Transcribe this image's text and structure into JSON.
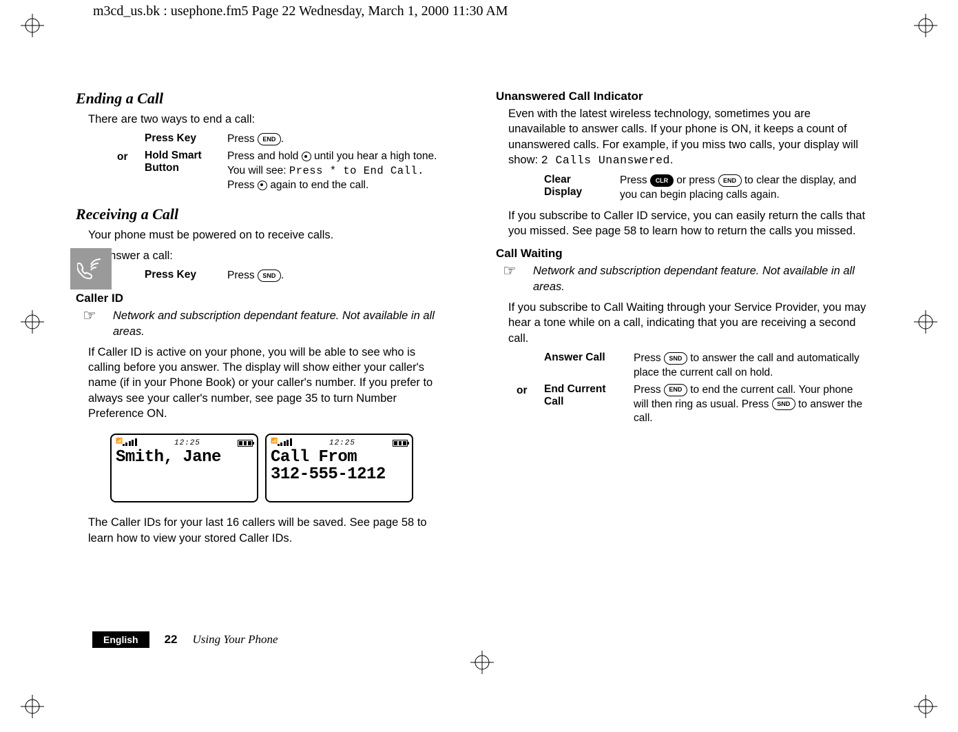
{
  "running_header": "m3cd_us.bk : usephone.fm5  Page 22  Wednesday, March 1, 2000  11:30 AM",
  "left": {
    "ending": {
      "title": "Ending a Call",
      "intro": "There are two ways to end a call:",
      "press_key_label": "Press Key",
      "press_key_desc_prefix": "Press ",
      "press_key_desc_suffix": ".",
      "or": "or",
      "hold_label_1": "Hold Smart",
      "hold_label_2": "Button",
      "hold_desc_1_prefix": "Press and hold ",
      "hold_desc_1_suffix": " until you hear a high tone. You will see: ",
      "hold_mono": "Press * to End Call.",
      "hold_desc_2_prefix": "Press ",
      "hold_desc_2_suffix": " again to end the call."
    },
    "receiving": {
      "title": "Receiving a Call",
      "line1": "Your phone must be powered on to receive calls.",
      "line2": "To answer a call:",
      "press_key_label": "Press Key",
      "press_key_desc_prefix": "Press ",
      "press_key_desc_suffix": "."
    },
    "callerid": {
      "title": "Caller ID",
      "note": "Network and subscription dependant feature. Not available in all areas.",
      "p1": "If Caller ID is active on your phone, you will be able to see who is calling before you answer. The display will show either your caller's name (if in your Phone Book) or your caller's number. If you prefer to always see your caller's number, see page 35 to turn Number Preference ON.",
      "screen1_time": "12:25",
      "screen1_line": "Smith, Jane",
      "screen2_time": "12:25",
      "screen2_line1": "Call From",
      "screen2_line2": "312-555-1212",
      "p2": "The Caller IDs for your last 16 callers will be saved. See page 58 to learn how to view your stored Caller IDs."
    }
  },
  "right": {
    "unanswered": {
      "title": "Unanswered Call Indicator",
      "p1_prefix": "Even with the latest wireless technology, sometimes you are unavailable to answer calls. If your phone is ON, it keeps a count of unanswered calls. For example, if you miss two calls, your display will show: ",
      "p1_mono": "2 Calls Unanswered",
      "p1_suffix": ".",
      "clear_label_1": "Clear",
      "clear_label_2": "Display",
      "clear_desc_prefix": "Press ",
      "clear_desc_mid": " or press ",
      "clear_desc_suffix": " to clear the display, and you can begin placing calls again.",
      "p2": "If you subscribe to Caller ID service, you can easily return the calls that you missed. See page 58 to learn how to return the calls you missed."
    },
    "callwaiting": {
      "title": "Call Waiting",
      "note": "Network and subscription dependant feature. Not available in all areas.",
      "p1": "If you subscribe to Call Waiting through your Service Provider, you may hear a tone while on a call, indicating that you are receiving a second call.",
      "answer_label": "Answer Call",
      "answer_desc_prefix": "Press ",
      "answer_desc_suffix": " to answer the call and automatically place the current call on hold.",
      "or": "or",
      "end_label_1": "End Current",
      "end_label_2": "Call",
      "end_desc_prefix": "Press ",
      "end_desc_mid": " to end the current call. Your phone will then ring as usual. Press ",
      "end_desc_suffix": " to answer the call."
    }
  },
  "keys": {
    "end": "END",
    "snd": "SND",
    "clr": "CLR"
  },
  "footer": {
    "lang": "English",
    "page": "22",
    "title": "Using Your Phone"
  }
}
